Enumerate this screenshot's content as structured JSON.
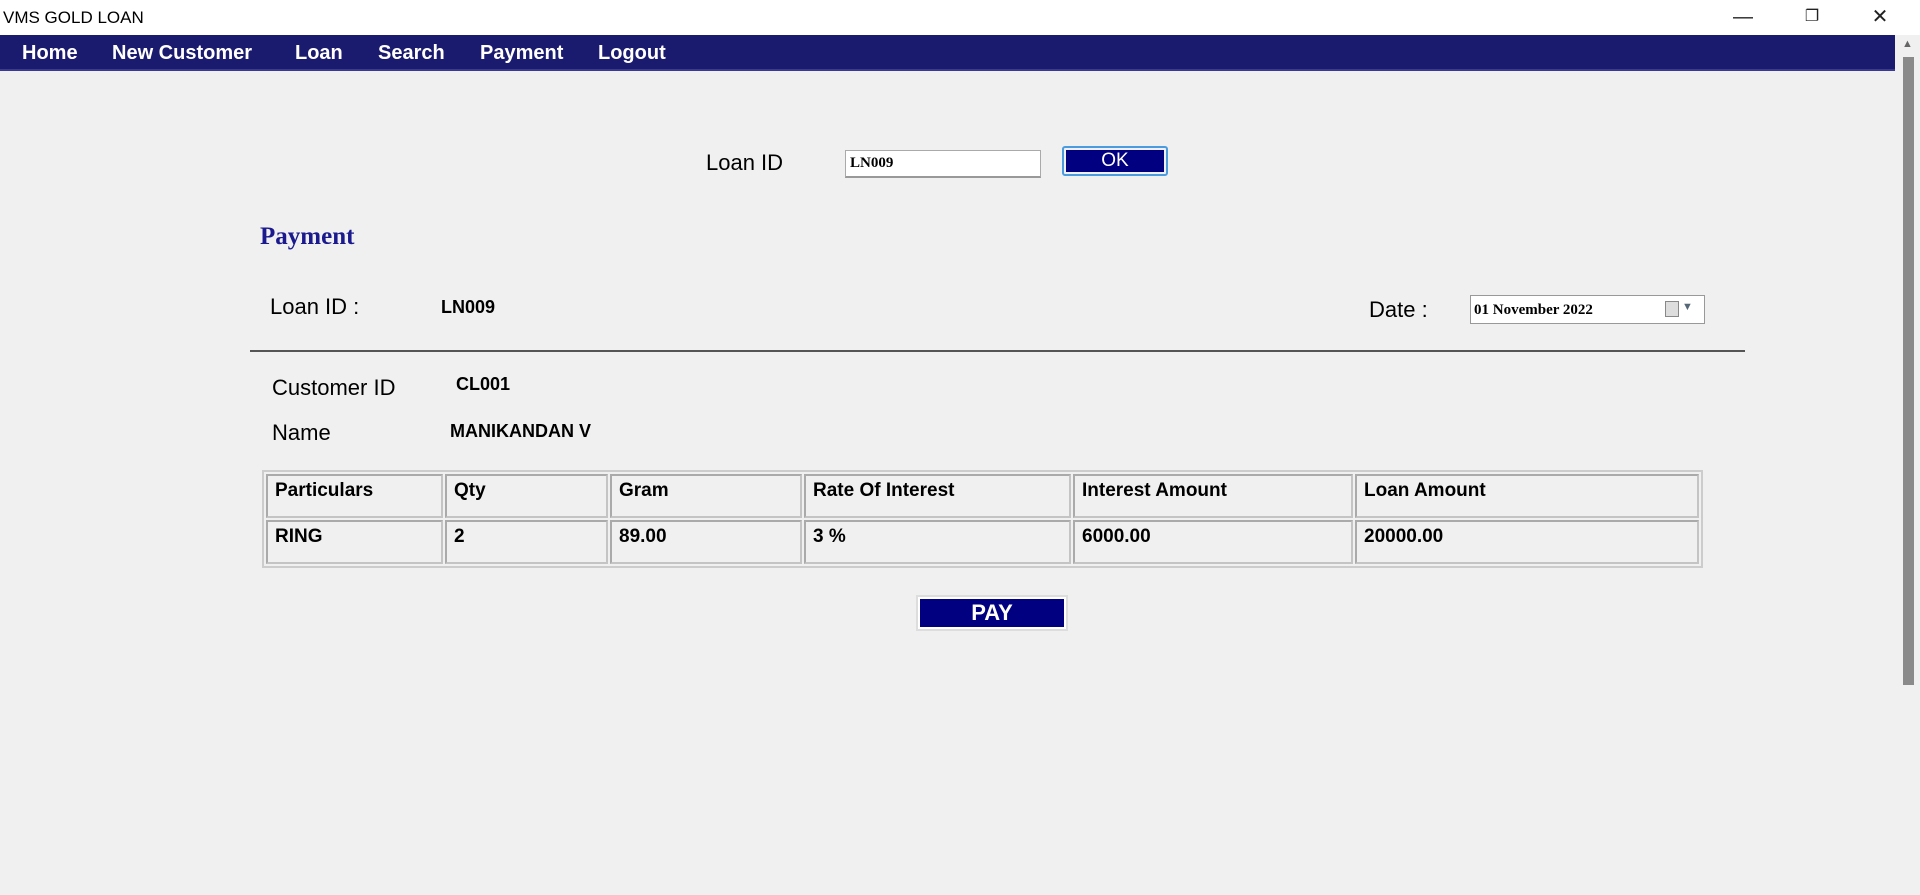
{
  "window": {
    "title": "VMS GOLD LOAN"
  },
  "nav": [
    "Home",
    "New Customer",
    "Loan",
    "Search",
    "Payment",
    "Logout"
  ],
  "search": {
    "label": "Loan ID",
    "value": "LN009",
    "button": "OK"
  },
  "section_title": "Payment",
  "loan": {
    "id_label": "Loan ID :",
    "id_value": "LN009",
    "date_label": "Date :",
    "date_value": "01 November 2022"
  },
  "customer": {
    "id_label": "Customer ID",
    "id_value": "CL001",
    "name_label": "Name",
    "name_value": "MANIKANDAN V"
  },
  "table": {
    "headers": [
      "Particulars",
      "Qty",
      "Gram",
      "Rate Of Interest",
      "Interest Amount",
      "Loan Amount"
    ],
    "rows": [
      [
        "RING",
        "2",
        "89.00",
        "3 %",
        "6000.00",
        "20000.00"
      ]
    ]
  },
  "pay_button": "PAY"
}
